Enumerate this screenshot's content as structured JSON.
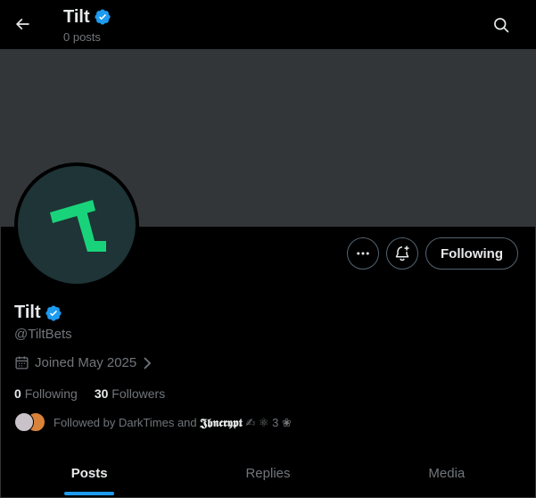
{
  "header": {
    "name": "Tilt",
    "posts_count": "0 posts"
  },
  "profile": {
    "name": "Tilt",
    "handle": "@TiltBets",
    "joined": "Joined May 2025",
    "following_count": "0",
    "following_label": "Following",
    "followers_count": "30",
    "followers_label": "Followers",
    "followed_by_prefix": "Followed by DarkTimes and ",
    "followed_by_name": "𝕵𝖇𝖓𝖈𝖗𝖞𝖕𝖙",
    "followed_by_emojis": "✍ ⚛ 3 ❀"
  },
  "actions": {
    "following_label": "Following"
  },
  "tabs": [
    {
      "label": "Posts",
      "active": true
    },
    {
      "label": "Replies",
      "active": false
    },
    {
      "label": "Media",
      "active": false
    }
  ],
  "colors": {
    "accent": "#1d9bf0",
    "banner": "#333639",
    "logo_green": "#19d37a",
    "logo_bg": "#1e3436"
  },
  "icons": {
    "back": "arrow-left-icon",
    "search": "search-icon",
    "more": "more-horizontal-icon",
    "notify": "bell-plus-icon",
    "calendar": "calendar-icon",
    "verified": "verified-badge-icon"
  }
}
